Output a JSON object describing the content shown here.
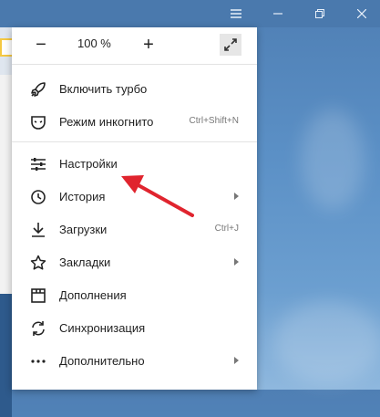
{
  "zoom": {
    "minus_label": "−",
    "value": "100 %",
    "plus_label": "+"
  },
  "menu": {
    "items": [
      {
        "label": "Включить турбо",
        "icon": "rocket-icon",
        "shortcut": "",
        "submenu": false
      },
      {
        "label": "Режим инкогнито",
        "icon": "incognito-mask-icon",
        "shortcut": "Ctrl+Shift+N",
        "submenu": false
      },
      {
        "label": "Настройки",
        "icon": "settings-sliders-icon",
        "shortcut": "",
        "submenu": false
      },
      {
        "label": "История",
        "icon": "clock-icon",
        "shortcut": "",
        "submenu": true
      },
      {
        "label": "Загрузки",
        "icon": "download-icon",
        "shortcut": "Ctrl+J",
        "submenu": false
      },
      {
        "label": "Закладки",
        "icon": "star-icon",
        "shortcut": "",
        "submenu": true
      },
      {
        "label": "Дополнения",
        "icon": "addons-icon",
        "shortcut": "",
        "submenu": false
      },
      {
        "label": "Синхронизация",
        "icon": "sync-icon",
        "shortcut": "",
        "submenu": false
      },
      {
        "label": "Дополнительно",
        "icon": "more-dots-icon",
        "shortcut": "",
        "submenu": true
      }
    ]
  },
  "colors": {
    "annotation_arrow": "#e0242e",
    "menu_background": "#ffffff",
    "desktop_background": "#5b90c6"
  }
}
